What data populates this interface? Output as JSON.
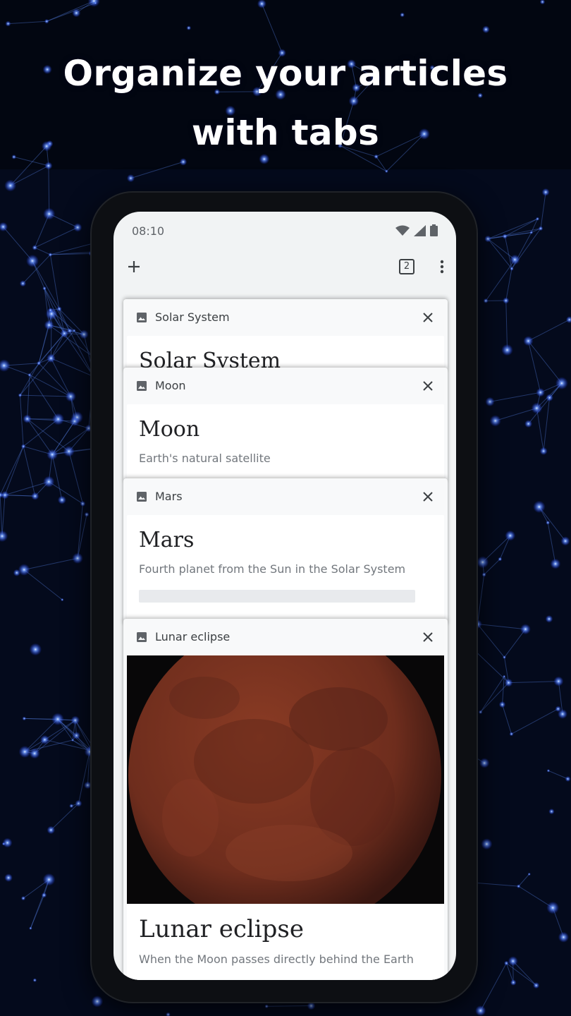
{
  "headline": {
    "line1": "Organize your articles",
    "line2": "with tabs"
  },
  "status_bar": {
    "time": "08:10",
    "icons": [
      "wifi-icon",
      "signal-icon",
      "battery-icon"
    ]
  },
  "toolbar": {
    "add_icon": "plus-icon",
    "tab_count": "2",
    "menu_icon": "more-vert-icon"
  },
  "tabs": [
    {
      "tab_label": "Solar System",
      "title": "Solar System",
      "description": ""
    },
    {
      "tab_label": "Moon",
      "title": "Moon",
      "description": "Earth's natural satellite"
    },
    {
      "tab_label": "Mars",
      "title": "Mars",
      "description": "Fourth planet from the Sun in the Solar System"
    },
    {
      "tab_label": "Lunar eclipse",
      "title": "Lunar eclipse",
      "description": "When the Moon passes directly behind the Earth"
    }
  ],
  "colors": {
    "background": "#040a1c",
    "star": "#4a7dff",
    "screen": "#f1f3f4",
    "moon": "#7a3422"
  }
}
